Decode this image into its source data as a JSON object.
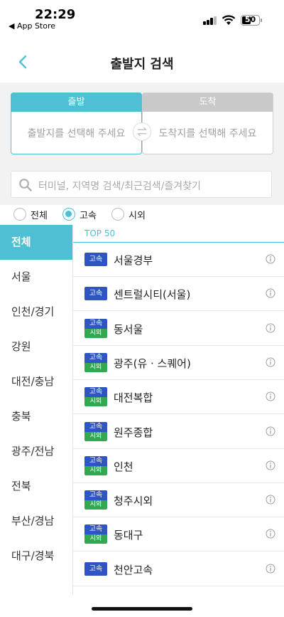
{
  "status_bar": {
    "time": "22:29",
    "back_app": "◀ App Store",
    "battery": "50"
  },
  "nav": {
    "title": "출발지 검색"
  },
  "route": {
    "departure_label": "출발",
    "departure_placeholder": "출발지를 선택해 주세요",
    "arrival_label": "도착",
    "arrival_placeholder": "도착지를 선택해 주세요"
  },
  "search": {
    "placeholder": "터미널, 지역명 검색/최근검색/즐겨찾기"
  },
  "filters": [
    {
      "label": "전체",
      "checked": false
    },
    {
      "label": "고속",
      "checked": true
    },
    {
      "label": "시외",
      "checked": false
    }
  ],
  "regions": [
    "전체",
    "서울",
    "인천/경기",
    "강원",
    "대전/충남",
    "충북",
    "광주/전남",
    "전북",
    "부산/경남",
    "대구/경북"
  ],
  "list_header": "TOP 50",
  "badges": {
    "express": "고속",
    "intercity": "시외"
  },
  "terminals": [
    {
      "name": "서울경부",
      "type": "express"
    },
    {
      "name": "센트럴시티(서울)",
      "type": "express"
    },
    {
      "name": "동서울",
      "type": "both"
    },
    {
      "name": "광주(유 · 스퀘어)",
      "type": "both"
    },
    {
      "name": "대전복합",
      "type": "both"
    },
    {
      "name": "원주종합",
      "type": "both"
    },
    {
      "name": "인천",
      "type": "both"
    },
    {
      "name": "청주시외",
      "type": "both"
    },
    {
      "name": "동대구",
      "type": "both"
    },
    {
      "name": "천안고속",
      "type": "express"
    }
  ],
  "colors": {
    "accent": "#4ec0d4",
    "express_badge": "#2f55c5",
    "intercity_badge": "#33a852"
  }
}
